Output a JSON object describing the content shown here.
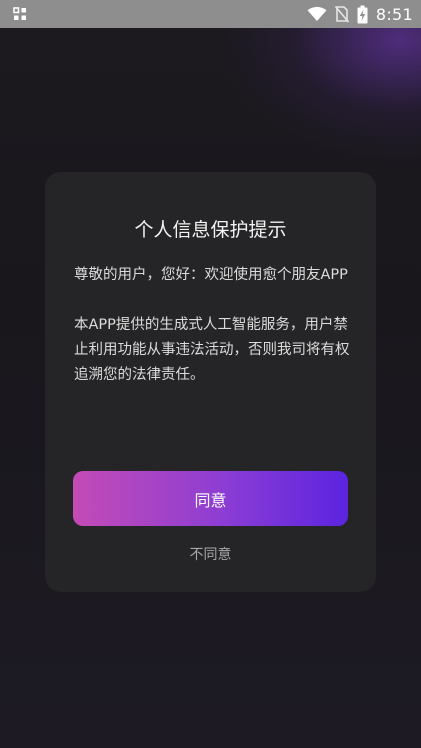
{
  "status_bar": {
    "time": "8:51",
    "left_icon": "notification-grid-icon",
    "icons": [
      "wifi-icon",
      "no-sim-icon",
      "battery-charging-icon"
    ]
  },
  "dialog": {
    "title": "个人信息保护提示",
    "greeting": "尊敬的用户，您好：欢迎使用愈个朋友APP",
    "notice": "本APP提供的生成式人工智能服务，用户禁止利用功能从事违法活动，否则我司将有权追溯您的法律责任。",
    "agree_label": "同意",
    "disagree_label": "不同意"
  },
  "colors": {
    "agree_gradient_start": "#c44bb6",
    "agree_gradient_end": "#5b24e0",
    "dialog_background": "#252527",
    "status_bar_background": "#8e8e8e"
  }
}
